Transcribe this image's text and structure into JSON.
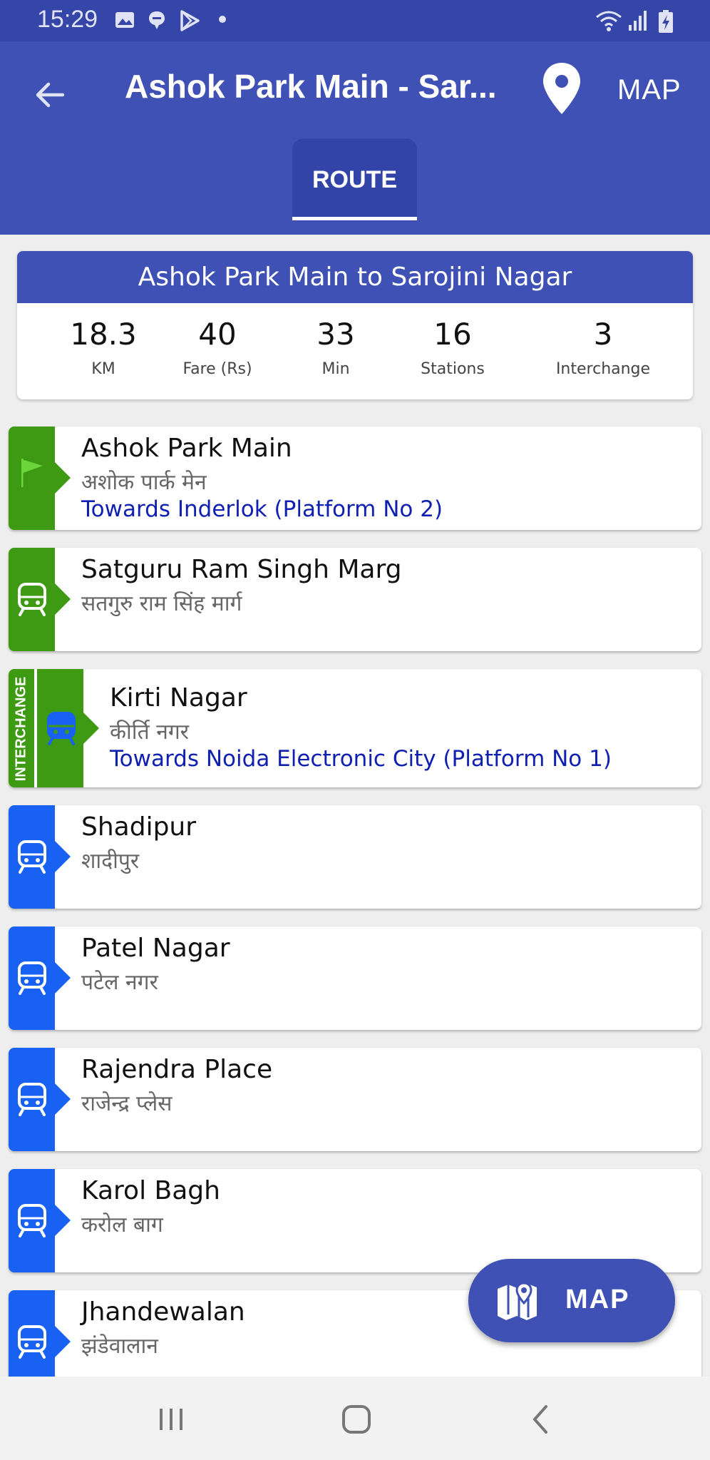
{
  "status_bar": {
    "time": "15:29",
    "icons": [
      "image-icon",
      "chat-icon",
      "play-store-icon",
      "dot-icon",
      "wifi-icon",
      "signal-icon",
      "battery-charging-icon"
    ]
  },
  "app_bar": {
    "back_icon": "arrow-left-icon",
    "title": "Ashok Park Main - Sar...",
    "pin_icon": "location-pin-icon",
    "map_label": "MAP",
    "tabs": [
      {
        "label": "ROUTE",
        "selected": true
      }
    ]
  },
  "summary": {
    "heading": "Ashok Park Main to Sarojini Nagar",
    "stats": [
      {
        "value": "18.3",
        "label": "KM"
      },
      {
        "value": "40",
        "label": "Fare (Rs)"
      },
      {
        "value": "33",
        "label": "Min"
      },
      {
        "value": "16",
        "label": "Stations"
      },
      {
        "value": "3",
        "label": "Interchange"
      }
    ]
  },
  "stations": [
    {
      "name": "Ashok Park Main",
      "hindi": "अशोक पार्क मेन",
      "towards": "Towards Inderlok (Platform No 2)",
      "line": "green",
      "icon": "flag-icon"
    },
    {
      "name": "Satguru Ram Singh Marg",
      "hindi": "सतगुरु राम सिंह मार्ग",
      "line": "green",
      "icon": "train-icon"
    },
    {
      "name": "Kirti Nagar",
      "hindi": "कीर्ति नगर",
      "towards": "Towards Noida Electronic City (Platform No 1)",
      "line": "green",
      "icon": "train-icon",
      "interchange_label": "INTERCHANGE"
    },
    {
      "name": "Shadipur",
      "hindi": "शादीपुर",
      "line": "blue",
      "icon": "train-icon"
    },
    {
      "name": "Patel Nagar",
      "hindi": "पटेल नगर",
      "line": "blue",
      "icon": "train-icon"
    },
    {
      "name": "Rajendra Place",
      "hindi": "राजेन्द्र प्लेस",
      "line": "blue",
      "icon": "train-icon"
    },
    {
      "name": "Karol Bagh",
      "hindi": "करोल बाग",
      "line": "blue",
      "icon": "train-icon"
    },
    {
      "name": "Jhandewalan",
      "hindi": "झंडेवालान",
      "line": "blue",
      "icon": "train-icon"
    }
  ],
  "fab": {
    "label": "MAP",
    "icon": "map-icon"
  },
  "nav_bar": {
    "icons": [
      "recents-icon",
      "home-icon",
      "back-icon"
    ]
  },
  "colors": {
    "primary": "#3f51b5",
    "status_bar": "#3645a8",
    "green_line": "#3d9a12",
    "blue_line": "#1961f2",
    "link": "#1020b0"
  }
}
